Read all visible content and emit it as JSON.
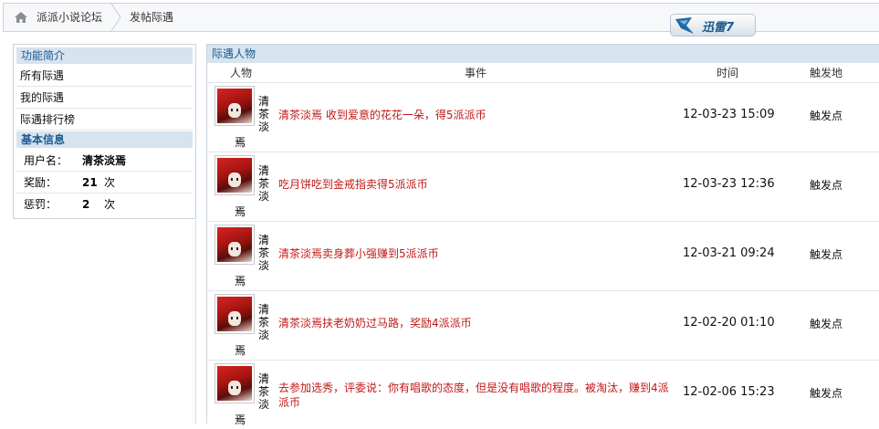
{
  "breadcrumb": {
    "home": "派派小说论坛",
    "current": "发帖际遇"
  },
  "badge": {
    "text": "迅雷7"
  },
  "sidebar": {
    "section1_title": "功能简介",
    "items": [
      {
        "label": "所有际遇"
      },
      {
        "label": "我的际遇"
      },
      {
        "label": "际遇排行榜"
      }
    ],
    "section2_title": "基本信息",
    "info": [
      {
        "key": "用户名：",
        "value": "清茶淡焉",
        "unit": ""
      },
      {
        "key": "奖励：",
        "value": "21",
        "unit": "次"
      },
      {
        "key": "惩罚：",
        "value": "2",
        "unit": "次"
      }
    ]
  },
  "main": {
    "title": "际遇人物",
    "columns": {
      "person": "人物",
      "event": "事件",
      "time": "时间",
      "place": "触发地"
    },
    "rows": [
      {
        "name_col": "清茶淡",
        "name_tail": "焉",
        "event": "清茶淡焉 收到爱意的花花一朵，得5派派币",
        "time": "12-03-23 15:09",
        "place": "触发点"
      },
      {
        "name_col": "清茶淡",
        "name_tail": "焉",
        "event": "吃月饼吃到金戒指卖得5派派币",
        "time": "12-03-23 12:36",
        "place": "触发点"
      },
      {
        "name_col": "清茶淡",
        "name_tail": "焉",
        "event": "清茶淡焉卖身葬小强赚到5派派币",
        "time": "12-03-21 09:24",
        "place": "触发点"
      },
      {
        "name_col": "清茶淡",
        "name_tail": "焉",
        "event": "清茶淡焉扶老奶奶过马路，奖励4派派币",
        "time": "12-02-20 01:10",
        "place": "触发点"
      },
      {
        "name_col": "清茶淡",
        "name_tail": "焉",
        "event": "去参加选秀，评委说：你有唱歌的态度，但是没有唱歌的程度。被淘汰，赚到4派派币",
        "time": "12-02-06 15:23",
        "place": "触发点"
      }
    ]
  },
  "colors": {
    "header_bg": "#d7e3ee",
    "header_text": "#1a5a91",
    "event_text": "#c21818"
  },
  "icons": {
    "home": "home-icon",
    "badge": "xunlei-bird-icon"
  }
}
